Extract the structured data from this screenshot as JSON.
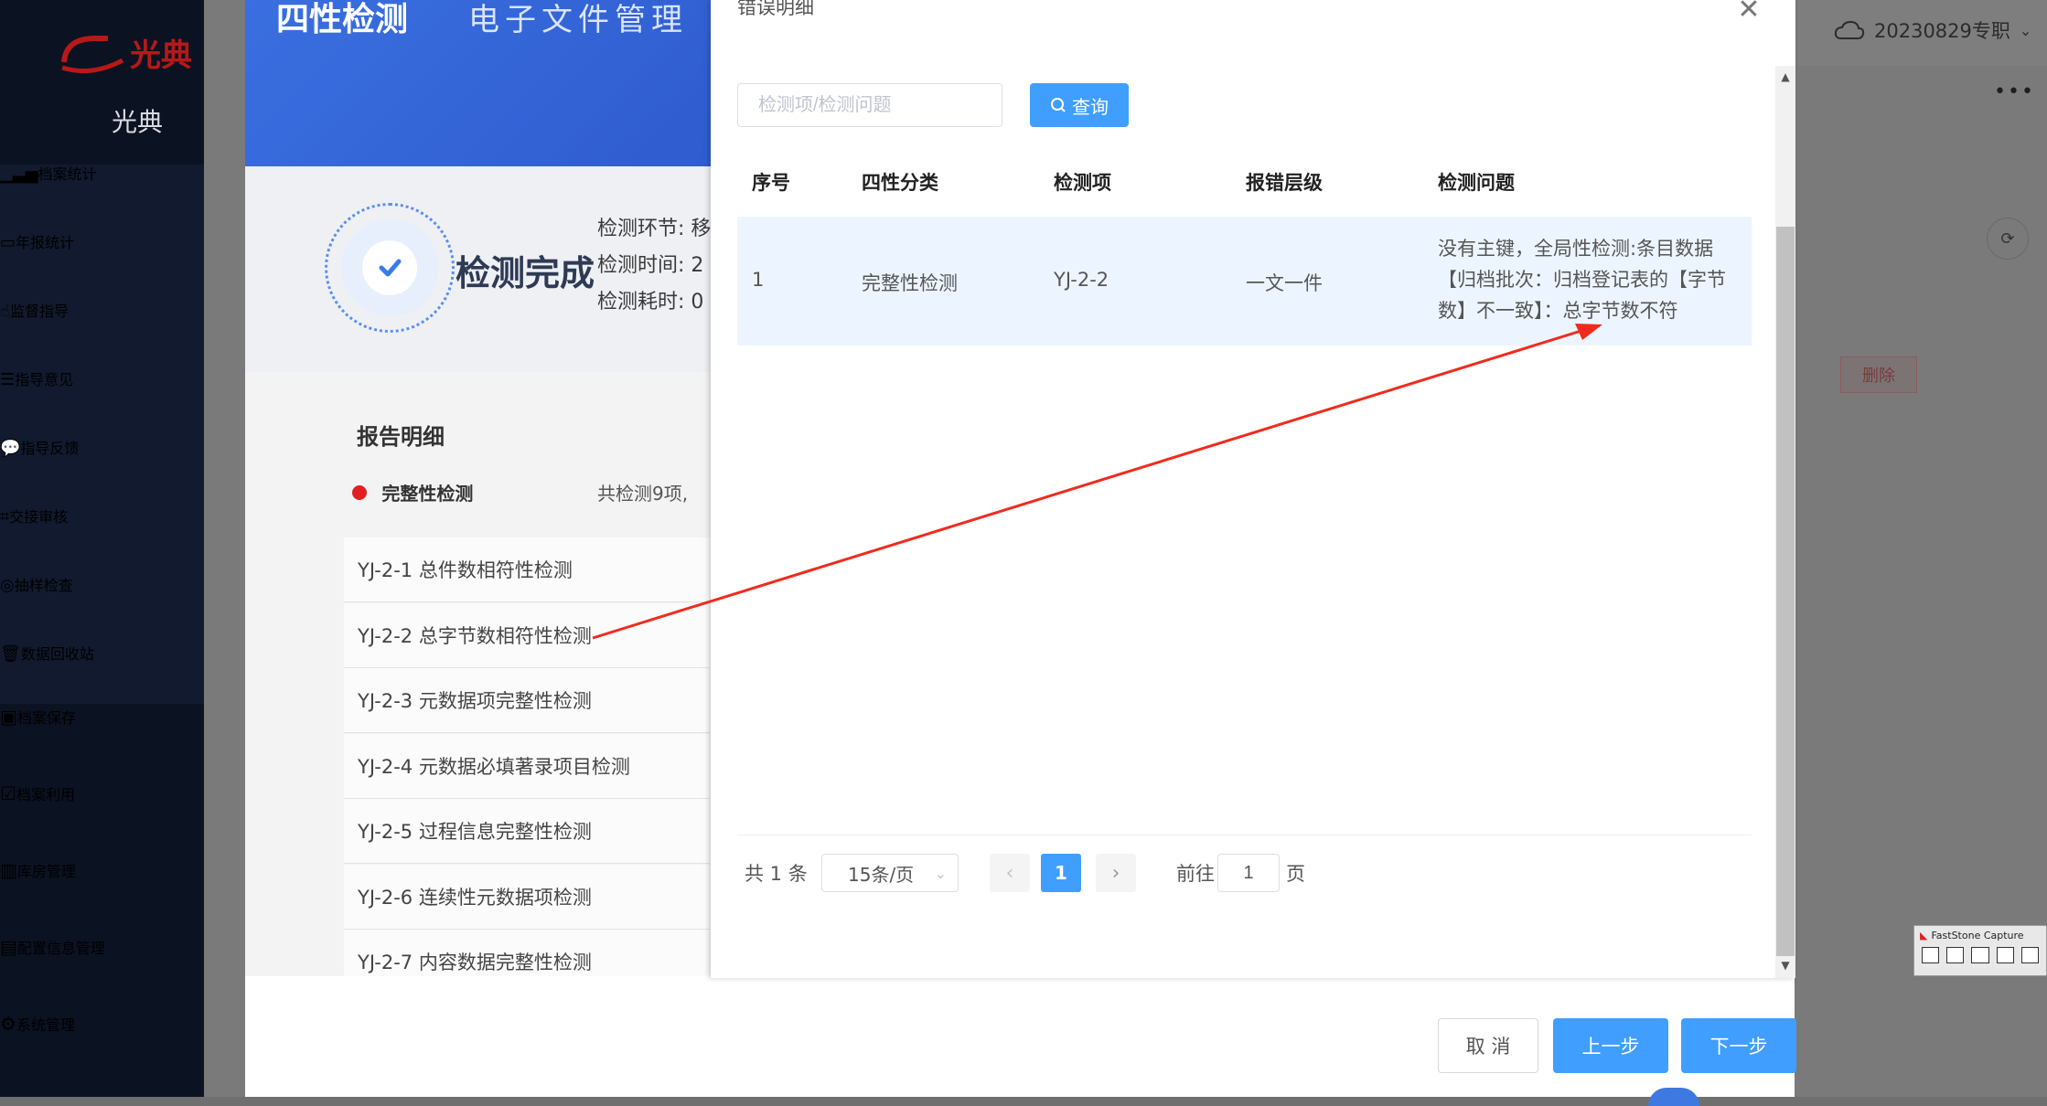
{
  "sidebar": {
    "brand": "光典",
    "sub_items": [
      {
        "label": "档案统计",
        "icon": "bar-chart-icon"
      },
      {
        "label": "年报统计",
        "icon": "monitor-icon"
      },
      {
        "label": "监督指导",
        "icon": "hand-icon"
      },
      {
        "label": "指导意见",
        "icon": "message-icon"
      },
      {
        "label": "指导反馈",
        "icon": "chat-icon"
      },
      {
        "label": "交接审核",
        "icon": "crop-icon"
      },
      {
        "label": "抽样检查",
        "icon": "target-icon"
      },
      {
        "label": "数据回收站",
        "icon": "trash-icon"
      }
    ],
    "main_items": [
      {
        "label": "档案保存",
        "icon": "archive-icon"
      },
      {
        "label": "档案利用",
        "icon": "clipboard-icon"
      },
      {
        "label": "库房管理",
        "icon": "building-icon"
      },
      {
        "label": "配置信息管理",
        "icon": "document-icon"
      },
      {
        "label": "系统管理",
        "icon": "gear-icon"
      }
    ]
  },
  "topbar": {
    "user": "20230829专职",
    "more": "•••"
  },
  "background": {
    "delete_label": "删除",
    "fscapture_title": "FastStone Capture"
  },
  "card": {
    "banner_title": "四性检测",
    "banner_sub": "电子文件管理",
    "status": "检测完成",
    "meta": [
      "检测环节: 移",
      "检测时间: 2",
      "检测耗时: 0"
    ],
    "report_title": "报告明细",
    "cut_row": {
      "label": "完整性检测",
      "right": "共检测9项,"
    },
    "items": [
      "YJ-2-1 总件数相符性检测",
      "YJ-2-2 总字节数相符性检测",
      "YJ-2-3 元数据项完整性检测",
      "YJ-2-4 元数据必填著录项目检测",
      "YJ-2-5 过程信息完整性检测",
      "YJ-2-6 连续性元数据项检测",
      "YJ-2-7 内容数据完整性检测"
    ]
  },
  "footer": {
    "cancel": "取 消",
    "prev": "上一步",
    "next": "下一步"
  },
  "modal": {
    "title": "错误明细",
    "search_placeholder": "检测项/检测问题",
    "query_label": "查询",
    "columns": [
      "序号",
      "四性分类",
      "检测项",
      "报错层级",
      "检测问题"
    ],
    "rows": [
      {
        "no": "1",
        "category": "完整性检测",
        "item": "YJ-2-2",
        "level": "一文一件",
        "problem": "没有主键，全局性检测:条目数据【归档批次：归档登记表的【字节数】不一致】：总字节数不符"
      }
    ],
    "pagination": {
      "total": "共 1 条",
      "page_size": "15条/页",
      "current": "1",
      "goto_label": "前往",
      "goto_value": "1",
      "goto_suffix": "页"
    }
  },
  "colors": {
    "primary": "#409eff",
    "sidebar": "#0b1222",
    "annotation_arrow": "#f02b1d"
  }
}
